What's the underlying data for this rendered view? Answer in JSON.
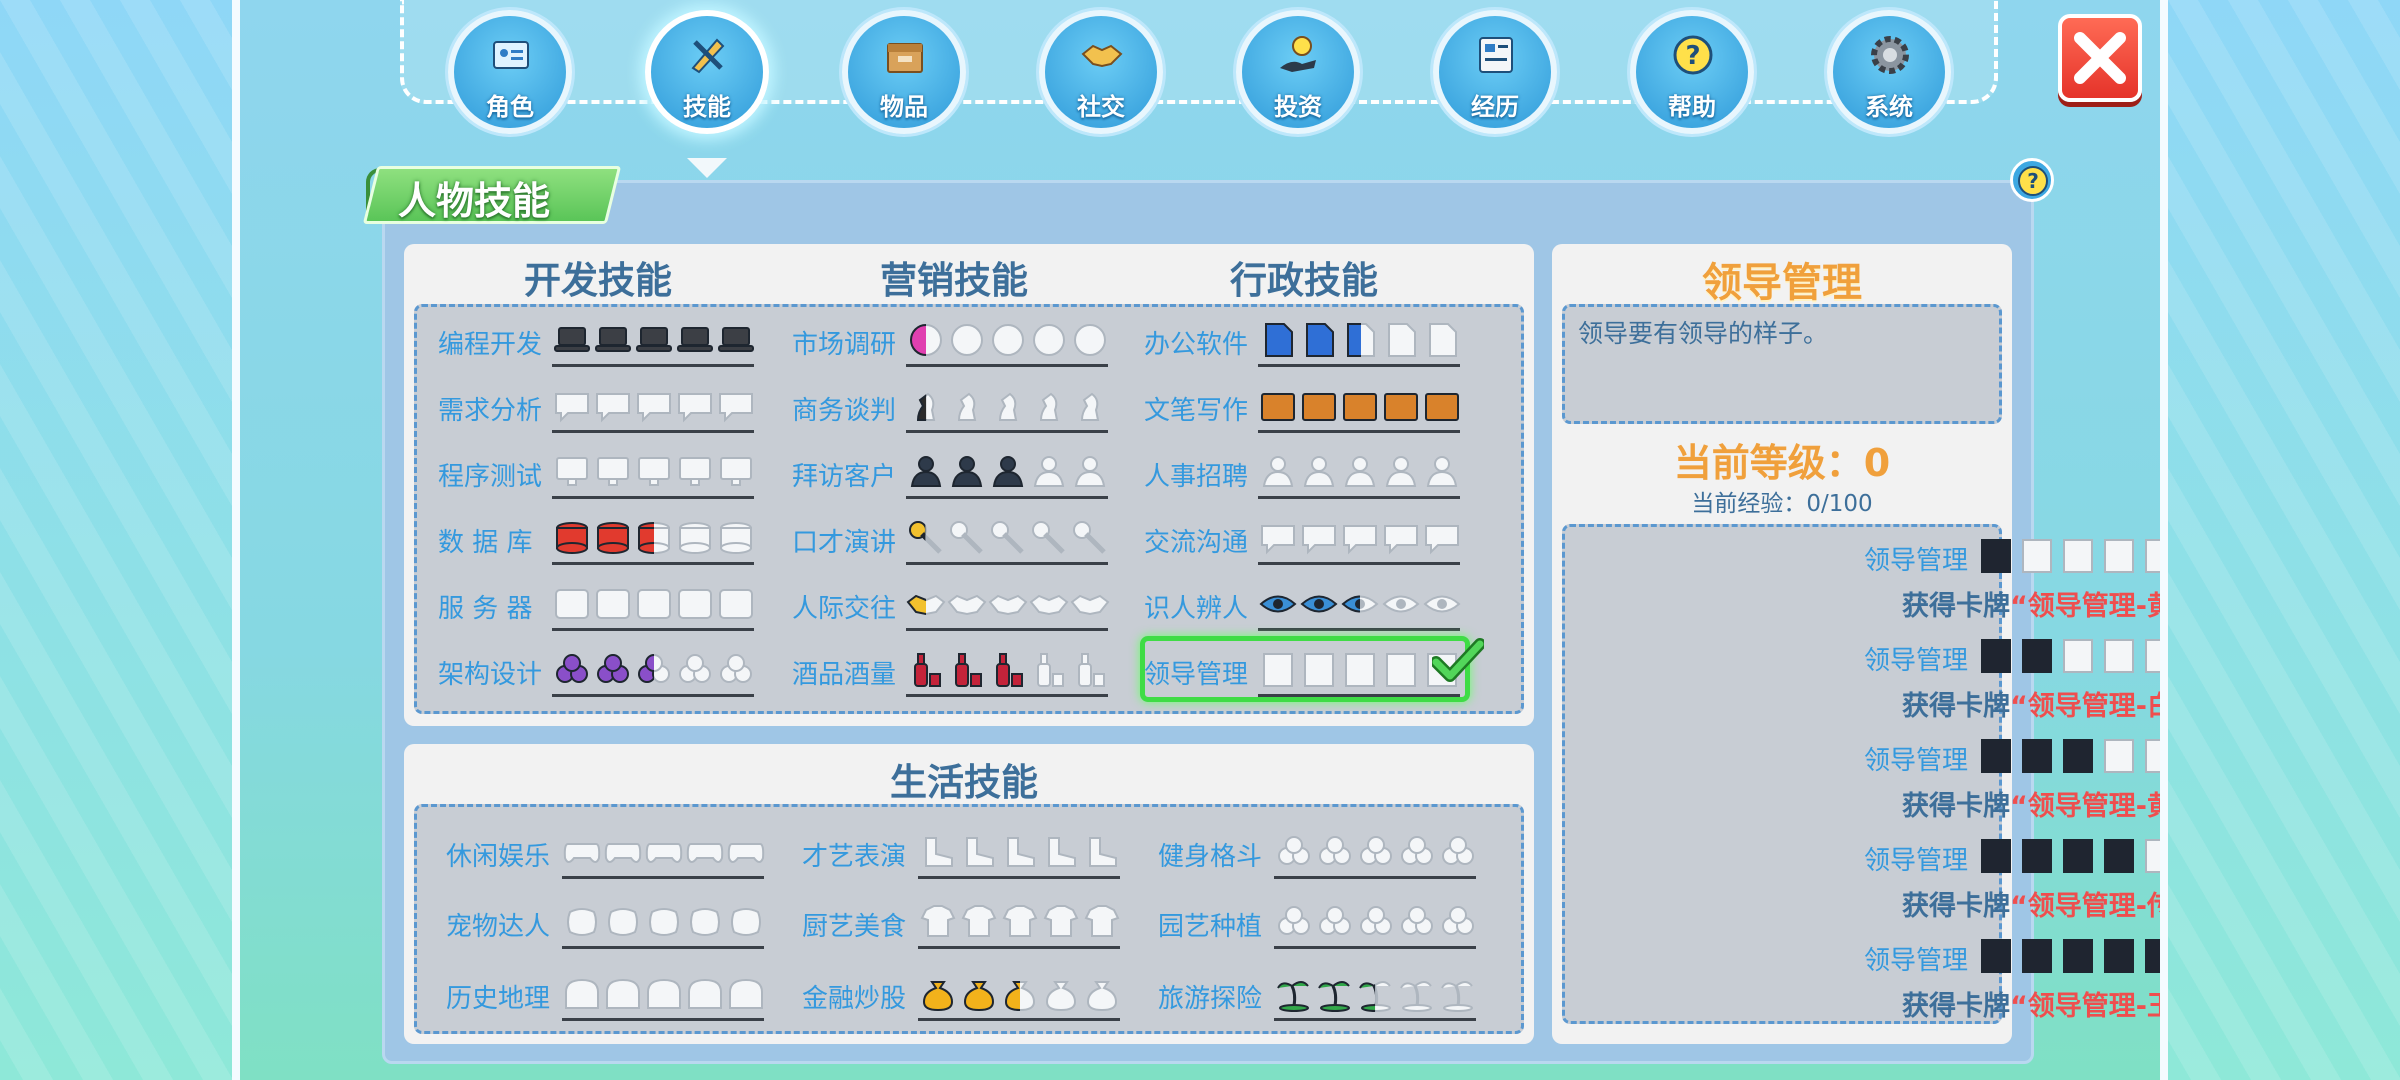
{
  "nav": [
    {
      "label": "角色",
      "icon": "id-card-icon"
    },
    {
      "label": "技能",
      "icon": "pencil-ruler-icon",
      "active": true
    },
    {
      "label": "物品",
      "icon": "box-icon"
    },
    {
      "label": "社交",
      "icon": "handshake-icon"
    },
    {
      "label": "投资",
      "icon": "coin-hand-icon"
    },
    {
      "label": "经历",
      "icon": "document-icon"
    },
    {
      "label": "帮助",
      "icon": "question-icon"
    },
    {
      "label": "系统",
      "icon": "gear-icon"
    }
  ],
  "panel_title": "人物技能",
  "columns": [
    "开发技能",
    "营销技能",
    "行政技能"
  ],
  "skills": {
    "dev": [
      {
        "name": "编程开发",
        "level": 5,
        "icon": "laptop-icon"
      },
      {
        "name": "需求分析",
        "level": 0,
        "icon": "speech-bubble-icon"
      },
      {
        "name": "程序测试",
        "level": 0,
        "icon": "monitor-icon"
      },
      {
        "name": "数 据 库",
        "level": 2.5,
        "icon": "database-icon"
      },
      {
        "name": "服 务 器",
        "level": 0,
        "icon": "server-icon"
      },
      {
        "name": "架构设计",
        "level": 2.5,
        "icon": "cubes-icon"
      }
    ],
    "mkt": [
      {
        "name": "市场调研",
        "level": 0.5,
        "icon": "pie-chart-icon"
      },
      {
        "name": "商务谈判",
        "level": 0.5,
        "icon": "chess-icon"
      },
      {
        "name": "拜访客户",
        "level": 3,
        "icon": "business-person-icon"
      },
      {
        "name": "口才演讲",
        "level": 0.5,
        "icon": "microphone-icon"
      },
      {
        "name": "人际交往",
        "level": 0.5,
        "icon": "handshake-icon"
      },
      {
        "name": "酒品酒量",
        "level": 3,
        "icon": "wine-bottle-icon"
      }
    ],
    "adm": [
      {
        "name": "办公软件",
        "level": 2.5,
        "icon": "word-doc-icon"
      },
      {
        "name": "文笔写作",
        "level": 5,
        "icon": "notebook-icon"
      },
      {
        "name": "人事招聘",
        "level": 0,
        "icon": "person-icon"
      },
      {
        "name": "交流沟通",
        "level": 0,
        "icon": "chat-icon"
      },
      {
        "name": "识人辨人",
        "level": 2.5,
        "icon": "eye-icon"
      },
      {
        "name": "领导管理",
        "level": 0,
        "icon": "suit-icon",
        "selected": true
      }
    ],
    "life_title": "生活技能",
    "life": [
      {
        "name": "休闲娱乐",
        "level": 0,
        "icon": "gamepad-icon"
      },
      {
        "name": "宠物达人",
        "level": 0,
        "icon": "pet-icon"
      },
      {
        "name": "历史地理",
        "level": 0,
        "icon": "globe-icon"
      },
      {
        "name": "才艺表演",
        "level": 0,
        "icon": "boot-icon"
      },
      {
        "name": "厨艺美食",
        "level": 0,
        "icon": "chef-hat-icon"
      },
      {
        "name": "金融炒股",
        "level": 2.5,
        "icon": "money-bag-icon"
      },
      {
        "name": "健身格斗",
        "level": 0,
        "icon": "fist-icon"
      },
      {
        "name": "园艺种植",
        "level": 0,
        "icon": "plant-icon"
      },
      {
        "name": "旅游探险",
        "level": 2.5,
        "icon": "palm-island-icon"
      }
    ]
  },
  "detail": {
    "title": "领导管理",
    "description": "领导要有领导的样子。",
    "current_level": "当前等级：0",
    "current_exp": "当前经验：0/100",
    "levels": [
      {
        "name": "领导管理",
        "filled": 1,
        "card_prefix": "获得卡牌",
        "card": "“领导管理-黄铜”"
      },
      {
        "name": "领导管理",
        "filled": 2,
        "card_prefix": "获得卡牌",
        "card": "“领导管理-白银”"
      },
      {
        "name": "领导管理",
        "filled": 3,
        "card_prefix": "获得卡牌",
        "card": "“领导管理-黄金”"
      },
      {
        "name": "领导管理",
        "filled": 4,
        "card_prefix": "获得卡牌",
        "card": "“领导管理-传奇”"
      },
      {
        "name": "领导管理",
        "filled": 5,
        "card_prefix": "获得卡牌",
        "card": "“领导管理-王者”"
      }
    ]
  },
  "colors": {
    "skill_text": "#3499de",
    "title_text": "#3d6f9a",
    "card_text": "#ef4e4e",
    "detail_title": "#f0a03c",
    "check": "#3dc94a"
  }
}
